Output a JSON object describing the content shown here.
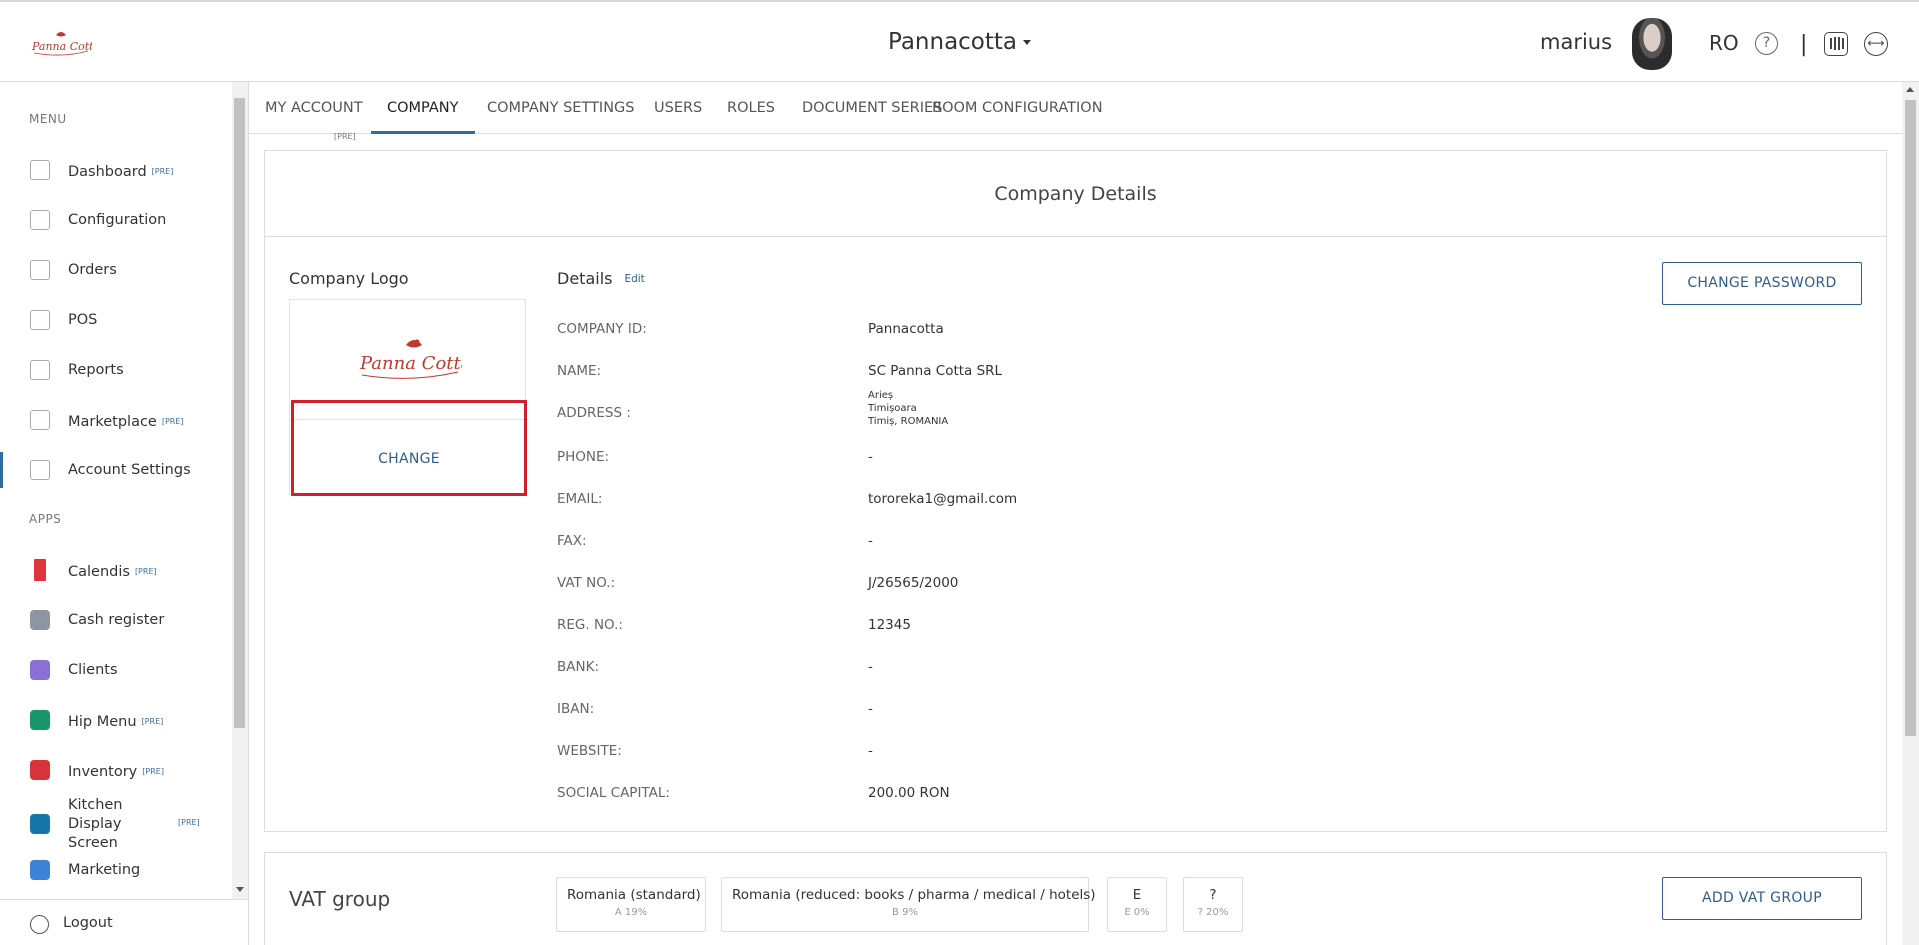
{
  "header": {
    "app_title": "Pannacotta",
    "username": "marius",
    "language": "RO",
    "help_glyph": "?",
    "separator": "|"
  },
  "sidebar": {
    "menu_label": "MENU",
    "apps_label": "APPS",
    "pre_badge": "[PRE]",
    "menu_items": [
      {
        "label": "Dashboard",
        "icon": "chart-icon",
        "pre": true
      },
      {
        "label": "Configuration",
        "icon": "tag-icon",
        "pre": false
      },
      {
        "label": "Orders",
        "icon": "bag-icon",
        "pre": false
      },
      {
        "label": "POS",
        "icon": "monitor-icon",
        "pre": false
      },
      {
        "label": "Reports",
        "icon": "report-icon",
        "pre": false
      },
      {
        "label": "Marketplace",
        "icon": "cart-icon",
        "pre": true
      },
      {
        "label": "Account Settings",
        "icon": "gear-icon",
        "pre": false,
        "active": true
      }
    ],
    "app_items": [
      {
        "label": "Calendis",
        "icon": "bookmark-icon",
        "pre": true,
        "color": "#e0343c"
      },
      {
        "label": "Cash register",
        "icon": "register-icon",
        "pre": false,
        "color": "#8e96a3"
      },
      {
        "label": "Clients",
        "icon": "people-icon",
        "pre": false,
        "color": "#8b6fd8"
      },
      {
        "label": "Hip Menu",
        "icon": "compass-icon",
        "pre": true,
        "color": "#18956b"
      },
      {
        "label": "Inventory",
        "icon": "cart-app-icon",
        "pre": true,
        "color": "#d8323a"
      },
      {
        "label": "Kitchen Display Screen",
        "icon": "cutlery-icon",
        "pre": true,
        "color": "#1775a8"
      },
      {
        "label": "Marketing",
        "icon": "percent-icon",
        "pre": false,
        "color": "#3d82d9"
      }
    ],
    "logout_label": "Logout"
  },
  "tabs": [
    {
      "label": "MY ACCOUNT"
    },
    {
      "label": "COMPANY",
      "active": true
    },
    {
      "label": "COMPANY SETTINGS"
    },
    {
      "label": "USERS"
    },
    {
      "label": "ROLES"
    },
    {
      "label": "DOCUMENT SERIES"
    },
    {
      "label": "ROOM CONFIGURATION"
    }
  ],
  "tab_pre_note": "[PRE]",
  "company": {
    "card_title": "Company Details",
    "logo_heading": "Company Logo",
    "change_label": "CHANGE",
    "details_heading": "Details",
    "edit_label": "Edit",
    "change_password_label": "CHANGE PASSWORD",
    "fields": [
      {
        "label": "COMPANY ID:",
        "value": "Pannacotta"
      },
      {
        "label": "NAME:",
        "value": "SC Panna Cotta SRL"
      },
      {
        "label": "ADDRESS :",
        "value": ""
      },
      {
        "label": "PHONE:",
        "value": "-"
      },
      {
        "label": "EMAIL:",
        "value": "tororeka1@gmail.com"
      },
      {
        "label": "FAX:",
        "value": "-"
      },
      {
        "label": "VAT NO.:",
        "value": "J/26565/2000"
      },
      {
        "label": "REG. NO.:",
        "value": "12345"
      },
      {
        "label": "BANK:",
        "value": "-"
      },
      {
        "label": "IBAN:",
        "value": "-"
      },
      {
        "label": "WEBSITE:",
        "value": "-"
      },
      {
        "label": "SOCIAL CAPITAL:",
        "value": "200.00 RON"
      }
    ],
    "address_lines": [
      "Arieș",
      "Timișoara",
      "Timiș, ROMANIA"
    ]
  },
  "vat": {
    "title": "VAT group",
    "add_label": "ADD VAT GROUP",
    "groups": [
      {
        "name": "Romania (standard)",
        "rate": "A 19%"
      },
      {
        "name": "Romania (reduced: books / pharma / medical / hotels)",
        "rate": "B 9%"
      },
      {
        "name": "E",
        "rate": "E 0%"
      },
      {
        "name": "?",
        "rate": "? 20%"
      }
    ]
  },
  "colors": {
    "accent": "#2f6ca4",
    "link": "#2f5d8a",
    "highlight_border": "#d0202a",
    "brand_logo": "#c0392b"
  }
}
